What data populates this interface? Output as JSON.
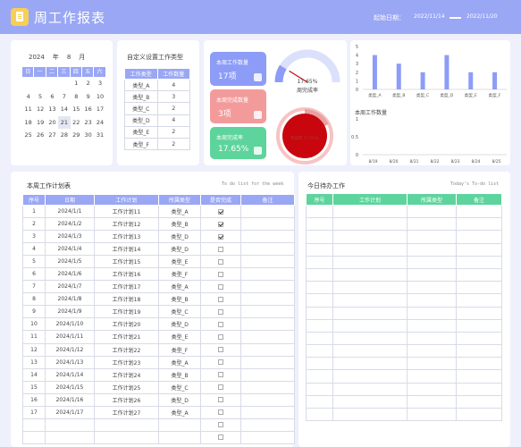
{
  "header": {
    "title": "周工作报表",
    "date_label": "起始日期：",
    "start_date": "2022/11/14",
    "end_date": "2022/11/20",
    "bg_color": "#9aa7f5",
    "logo_icon": "clipboard-icon"
  },
  "calendar": {
    "year": "2024",
    "year_unit": "年",
    "month": "8",
    "month_unit": "月",
    "weekdays": [
      "日",
      "一",
      "二",
      "三",
      "四",
      "五",
      "六"
    ],
    "weeks": [
      [
        "",
        "",
        "",
        "",
        "1",
        "2",
        "3"
      ],
      [
        "4",
        "5",
        "6",
        "7",
        "8",
        "9",
        "10"
      ],
      [
        "11",
        "12",
        "13",
        "14",
        "15",
        "16",
        "17"
      ],
      [
        "18",
        "19",
        "20",
        "21",
        "22",
        "23",
        "24"
      ],
      [
        "25",
        "26",
        "27",
        "28",
        "29",
        "30",
        "31"
      ]
    ],
    "highlighted_day": "21"
  },
  "types": {
    "title": "自定义设置工作类型",
    "headers": [
      "工作类型",
      "工作数量"
    ],
    "rows": [
      [
        "类型_A",
        "4"
      ],
      [
        "类型_B",
        "3"
      ],
      [
        "类型_C",
        "2"
      ],
      [
        "类型_D",
        "4"
      ],
      [
        "类型_E",
        "2"
      ],
      [
        "类型_F",
        "2"
      ]
    ]
  },
  "stats": {
    "total_label": "本周工作数量",
    "total_value": "17项",
    "done_label": "本周完成数量",
    "done_value": "3项",
    "rate_label": "本周完成率",
    "rate_value": "17.65%",
    "colors": {
      "total": "#8d9cf6",
      "done": "#f39b9b",
      "rate": "#5dd49b"
    }
  },
  "gauge": {
    "value_text": "17.65%",
    "label": "周完成率",
    "fraction": 0.1765,
    "color": "#8d9cf6"
  },
  "donut": {
    "fraction": 0.1765,
    "value_text": "完成率 17.65%",
    "color": "#c9050d"
  },
  "bar_chart": {
    "type": "bar",
    "categories": [
      "类型_A",
      "类型_B",
      "类型_C",
      "类型_D",
      "类型_E",
      "类型_F"
    ],
    "values": [
      4,
      3,
      2,
      4,
      2,
      2
    ],
    "y_ticks": [
      "0",
      "1",
      "2",
      "3",
      "4",
      "5"
    ],
    "ylim": [
      0,
      5
    ],
    "color": "#8d9cf6"
  },
  "daily_chart": {
    "title": "本周工作数量",
    "categories": [
      "8/19",
      "8/20",
      "8/21",
      "8/22",
      "8/23",
      "8/24",
      "8/25"
    ],
    "y_ticks": [
      "0",
      "0.5",
      "1"
    ],
    "ylim": [
      0,
      1
    ]
  },
  "plan": {
    "title": "本周工作计划表",
    "subtitle": "To do list for the week",
    "headers": [
      "序号",
      "日期",
      "工作计划",
      "所属类型",
      "是否完成",
      "备注"
    ],
    "rows": [
      [
        "1",
        "2024/1/1",
        "工作计划11",
        "类型_A",
        true
      ],
      [
        "2",
        "2024/1/2",
        "工作计划12",
        "类型_B",
        true
      ],
      [
        "3",
        "2024/1/3",
        "工作计划13",
        "类型_D",
        true
      ],
      [
        "4",
        "2024/1/4",
        "工作计划14",
        "类型_D",
        false
      ],
      [
        "5",
        "2024/1/5",
        "工作计划15",
        "类型_E",
        false
      ],
      [
        "6",
        "2024/1/6",
        "工作计划16",
        "类型_F",
        false
      ],
      [
        "7",
        "2024/1/7",
        "工作计划17",
        "类型_A",
        false
      ],
      [
        "8",
        "2024/1/8",
        "工作计划18",
        "类型_B",
        false
      ],
      [
        "9",
        "2024/1/9",
        "工作计划19",
        "类型_C",
        false
      ],
      [
        "10",
        "2024/1/10",
        "工作计划20",
        "类型_D",
        false
      ],
      [
        "11",
        "2024/1/11",
        "工作计划21",
        "类型_E",
        false
      ],
      [
        "12",
        "2024/1/12",
        "工作计划22",
        "类型_F",
        false
      ],
      [
        "13",
        "2024/1/13",
        "工作计划23",
        "类型_A",
        false
      ],
      [
        "14",
        "2024/1/14",
        "工作计划24",
        "类型_B",
        false
      ],
      [
        "15",
        "2024/1/15",
        "工作计划25",
        "类型_C",
        false
      ],
      [
        "16",
        "2024/1/16",
        "工作计划26",
        "类型_D",
        false
      ],
      [
        "17",
        "2024/1/17",
        "工作计划27",
        "类型_A",
        false
      ],
      [
        "",
        "",
        "",
        "",
        false
      ],
      [
        "",
        "",
        "",
        "",
        false
      ]
    ]
  },
  "todo": {
    "title": "今日待办工作",
    "subtitle": "Today's To-do list",
    "headers": [
      "序号",
      "工作计划",
      "所属类型",
      "备注"
    ],
    "empty_rows": 17
  }
}
